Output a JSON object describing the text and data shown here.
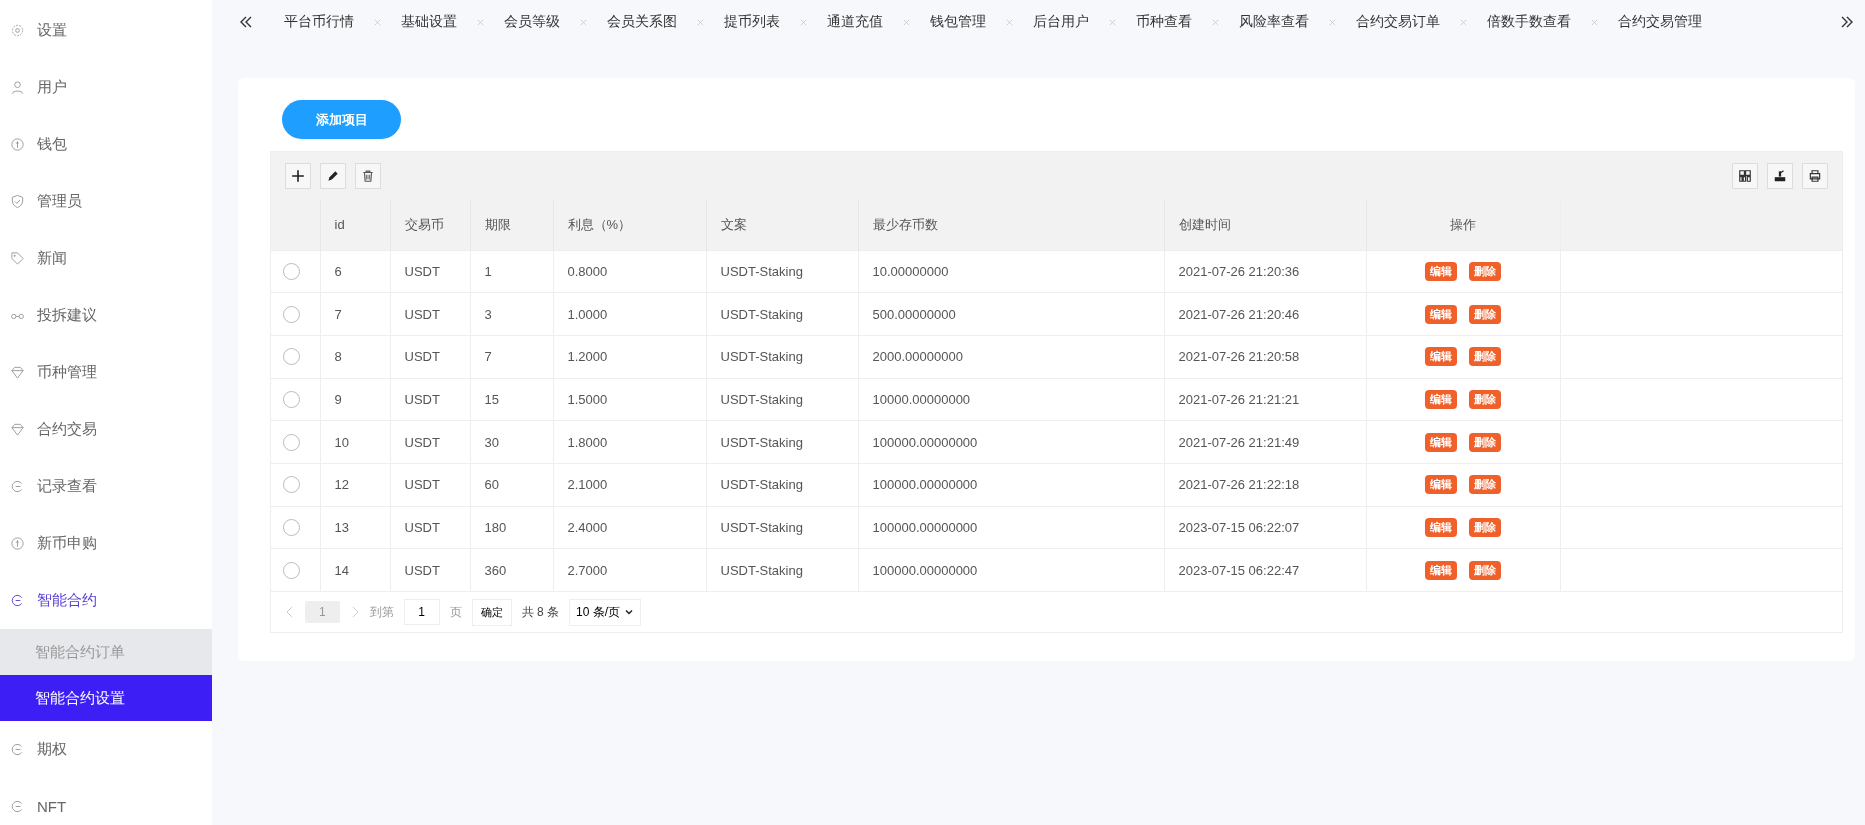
{
  "sidebar": {
    "items": [
      {
        "label": "设置",
        "expanded": false
      },
      {
        "label": "用户",
        "expanded": false
      },
      {
        "label": "钱包",
        "expanded": false
      },
      {
        "label": "管理员",
        "expanded": false
      },
      {
        "label": "新闻",
        "expanded": false
      },
      {
        "label": "投拆建议",
        "expanded": false
      },
      {
        "label": "币种管理",
        "expanded": false
      },
      {
        "label": "合约交易",
        "expanded": false
      },
      {
        "label": "记录查看",
        "expanded": false
      },
      {
        "label": "新币申购",
        "expanded": false
      },
      {
        "label": "智能合约",
        "expanded": true,
        "children": [
          {
            "label": "智能合约订单",
            "selected": false
          },
          {
            "label": "智能合约设置",
            "selected": true
          }
        ]
      },
      {
        "label": "期权",
        "expanded": false
      },
      {
        "label": "NFT",
        "expanded": false
      }
    ]
  },
  "tabs": [
    {
      "label": "平台币行情"
    },
    {
      "label": "基础设置"
    },
    {
      "label": "会员等级"
    },
    {
      "label": "会员关系图"
    },
    {
      "label": "提币列表"
    },
    {
      "label": "通道充值"
    },
    {
      "label": "钱包管理"
    },
    {
      "label": "后台用户"
    },
    {
      "label": "币种查看"
    },
    {
      "label": "风险率查看"
    },
    {
      "label": "合约交易订单"
    },
    {
      "label": "倍数手数查看"
    },
    {
      "label": "合约交易管理"
    }
  ],
  "add_button": "添加项目",
  "table": {
    "columns": [
      "id",
      "交易币",
      "期限",
      "利息（%）",
      "文案",
      "最少存币数",
      "创建时间",
      "操作"
    ],
    "rows": [
      {
        "selected": false,
        "cells": [
          "6",
          "USDT",
          "1",
          "0.8000",
          "USDT-Staking",
          "10.00000000",
          "2021-07-26 21:20:36"
        ],
        "actions": [
          "编辑",
          "删除"
        ]
      },
      {
        "selected": false,
        "cells": [
          "7",
          "USDT",
          "3",
          "1.0000",
          "USDT-Staking",
          "500.00000000",
          "2021-07-26 21:20:46"
        ],
        "actions": [
          "编辑",
          "删除"
        ]
      },
      {
        "selected": false,
        "cells": [
          "8",
          "USDT",
          "7",
          "1.2000",
          "USDT-Staking",
          "2000.00000000",
          "2021-07-26 21:20:58"
        ],
        "actions": [
          "编辑",
          "删除"
        ]
      },
      {
        "selected": false,
        "cells": [
          "9",
          "USDT",
          "15",
          "1.5000",
          "USDT-Staking",
          "10000.00000000",
          "2021-07-26 21:21:21"
        ],
        "actions": [
          "编辑",
          "删除"
        ]
      },
      {
        "selected": false,
        "cells": [
          "10",
          "USDT",
          "30",
          "1.8000",
          "USDT-Staking",
          "100000.00000000",
          "2021-07-26 21:21:49"
        ],
        "actions": [
          "编辑",
          "删除"
        ]
      },
      {
        "selected": false,
        "cells": [
          "12",
          "USDT",
          "60",
          "2.1000",
          "USDT-Staking",
          "100000.00000000",
          "2021-07-26 21:22:18"
        ],
        "actions": [
          "编辑",
          "删除"
        ]
      },
      {
        "selected": false,
        "cells": [
          "13",
          "USDT",
          "180",
          "2.4000",
          "USDT-Staking",
          "100000.00000000",
          "2023-07-15 06:22:07"
        ],
        "actions": [
          "编辑",
          "删除"
        ]
      },
      {
        "selected": false,
        "cells": [
          "14",
          "USDT",
          "360",
          "2.7000",
          "USDT-Staking",
          "100000.00000000",
          "2023-07-15 06:22:47"
        ],
        "actions": [
          "编辑",
          "删除"
        ]
      }
    ]
  },
  "pager": {
    "current": "1",
    "goto_label": "到第",
    "goto_value": "1",
    "page_unit": "页",
    "confirm": "确定",
    "total": "共 8 条",
    "page_size": "10 条/页"
  }
}
